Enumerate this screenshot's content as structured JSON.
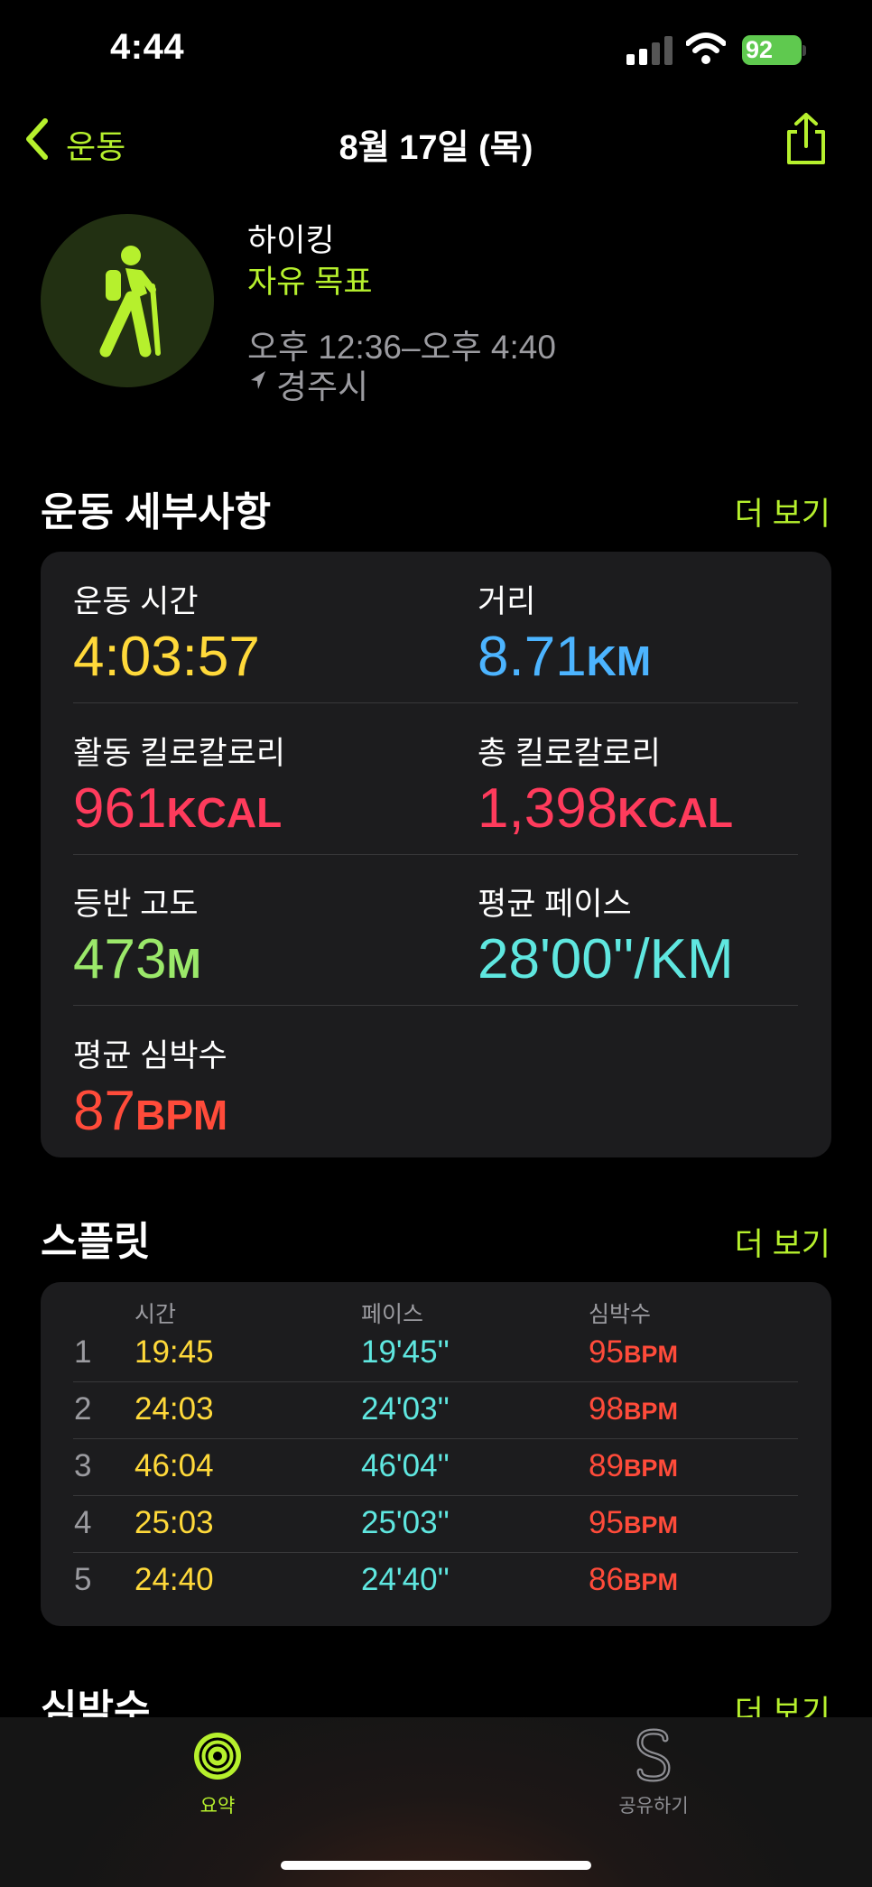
{
  "status_bar": {
    "time": "4:44",
    "battery_level": "92",
    "signal_bars_active": 2,
    "signal_bars_total": 4
  },
  "nav": {
    "back_label": "운동",
    "title": "8월 17일 (목)",
    "back_icon": "chevron-left-icon",
    "share_icon": "share-icon"
  },
  "workout": {
    "type": "하이킹",
    "goal": "자유 목표",
    "time_range": "오후 12:36–오후 4:40",
    "location": "경주시",
    "icon": "hiking-figure-icon"
  },
  "details": {
    "section_title": "운동 세부사항",
    "more_label": "더 보기",
    "metrics": [
      {
        "label": "운동 시간",
        "value": "4:03:57",
        "unit": "",
        "color": "#ffd93a"
      },
      {
        "label": "거리",
        "value": "8.71",
        "unit": "KM",
        "color": "#4cb4ff"
      },
      {
        "label": "활동 킬로칼로리",
        "value": "961",
        "unit": "KCAL",
        "color": "#ff3b5c"
      },
      {
        "label": "총 킬로칼로리",
        "value": "1,398",
        "unit": "KCAL",
        "color": "#ff3b5c"
      },
      {
        "label": "등반 고도",
        "value": "473",
        "unit": "M",
        "color": "#9be86a"
      },
      {
        "label": "평균 페이스",
        "value": "28'00''/KM",
        "unit": "",
        "color": "#5fe7e0"
      },
      {
        "label": "평균 심박수",
        "value": "87",
        "unit": "BPM",
        "color": "#ff4b3a"
      }
    ]
  },
  "splits": {
    "section_title": "스플릿",
    "more_label": "더 보기",
    "headers": {
      "time": "시간",
      "pace": "페이스",
      "heart_rate": "심박수"
    },
    "hr_unit": "BPM",
    "rows": [
      {
        "index": "1",
        "time": "19:45",
        "pace": "19'45''",
        "hr": "95"
      },
      {
        "index": "2",
        "time": "24:03",
        "pace": "24'03''",
        "hr": "98"
      },
      {
        "index": "3",
        "time": "46:04",
        "pace": "46'04''",
        "hr": "89"
      },
      {
        "index": "4",
        "time": "25:03",
        "pace": "25'03''",
        "hr": "95"
      },
      {
        "index": "5",
        "time": "24:40",
        "pace": "24'40''",
        "hr": "86"
      }
    ]
  },
  "heart_rate_section": {
    "section_title": "심박수",
    "more_label": "더 보기"
  },
  "tabbar": {
    "summary_label": "요약",
    "share_label": "공유하기",
    "summary_icon": "activity-rings-icon",
    "share_icon": "sharing-s-icon"
  },
  "colors": {
    "accent_green": "#b6f02d",
    "card_bg": "#1c1c1e",
    "secondary_text": "#9b9ba0"
  }
}
